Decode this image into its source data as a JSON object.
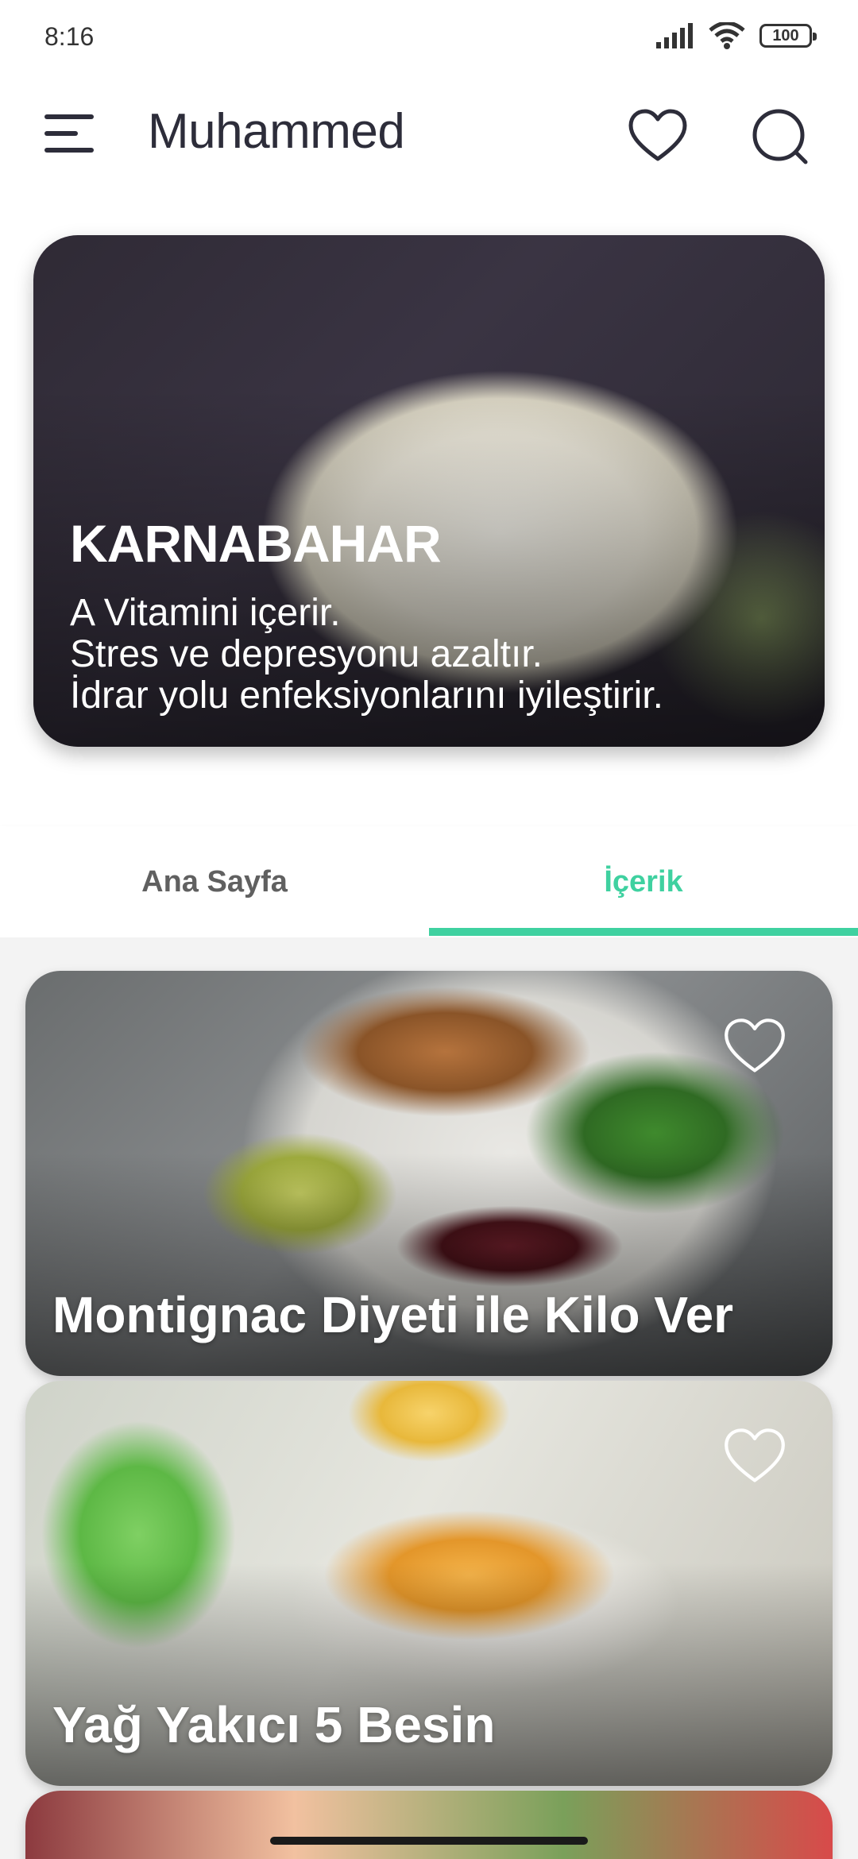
{
  "status_bar": {
    "time": "8:16",
    "battery": "100"
  },
  "app_bar": {
    "title": "Muhammed"
  },
  "hero": {
    "title": "KARNABAHAR",
    "lines": [
      "A Vitamini içerir.",
      "Stres ve depresyonu azaltır.",
      "İdrar yolu enfeksiyonlarını iyileştirir."
    ]
  },
  "tabs": [
    {
      "label": "Ana Sayfa",
      "active": false
    },
    {
      "label": "İçerik",
      "active": true
    }
  ],
  "cards": [
    {
      "title": "Montignac Diyeti ile Kilo Ver"
    },
    {
      "title": "Yağ Yakıcı 5 Besin"
    }
  ],
  "colors": {
    "accent": "#3fd1a0",
    "text": "#2d2d3a"
  },
  "icons": [
    "menu-icon",
    "heart-icon",
    "search-icon",
    "signal-icon",
    "wifi-icon",
    "battery-icon"
  ]
}
